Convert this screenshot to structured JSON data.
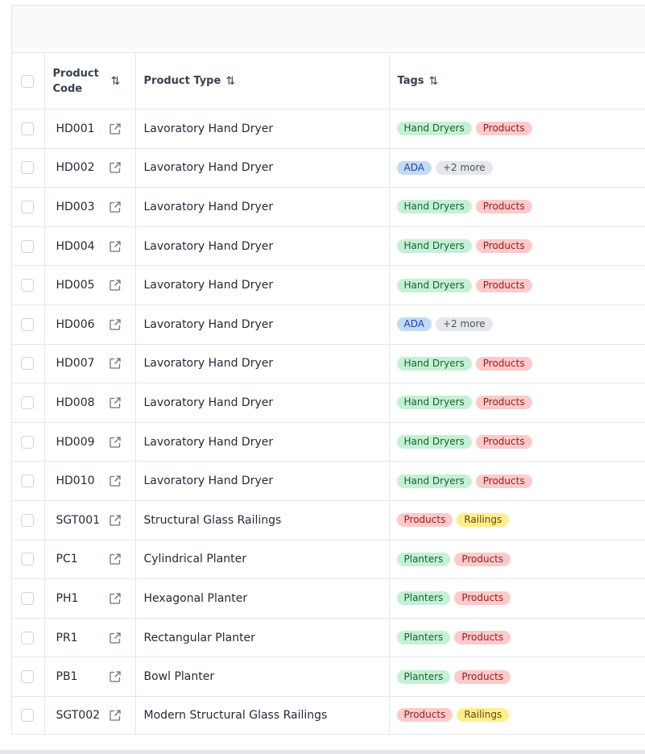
{
  "table": {
    "headers": {
      "code": "Product Code",
      "type": "Product Type",
      "tags": "Tags",
      "sort_glyph": "⇅"
    },
    "tag_colors": {
      "Hand Dryers": "#c6f0d4",
      "Products": "#fbcaca",
      "ADA": "#c3daf7",
      "+2 more": "#e5e7eb",
      "Railings": "#fdf08a",
      "Planters": "#c6f0d4"
    },
    "rows": [
      {
        "code": "HD001",
        "type": "Lavoratory Hand Dryer",
        "tags": [
          {
            "label": "Hand Dryers",
            "color": "green"
          },
          {
            "label": "Products",
            "color": "red"
          }
        ]
      },
      {
        "code": "HD002",
        "type": "Lavoratory Hand Dryer",
        "tags": [
          {
            "label": "ADA",
            "color": "blue"
          },
          {
            "label": "+2 more",
            "color": "gray"
          }
        ]
      },
      {
        "code": "HD003",
        "type": "Lavoratory Hand Dryer",
        "tags": [
          {
            "label": "Hand Dryers",
            "color": "green"
          },
          {
            "label": "Products",
            "color": "red"
          }
        ]
      },
      {
        "code": "HD004",
        "type": "Lavoratory Hand Dryer",
        "tags": [
          {
            "label": "Hand Dryers",
            "color": "green"
          },
          {
            "label": "Products",
            "color": "red"
          }
        ]
      },
      {
        "code": "HD005",
        "type": "Lavoratory Hand Dryer",
        "tags": [
          {
            "label": "Hand Dryers",
            "color": "green"
          },
          {
            "label": "Products",
            "color": "red"
          }
        ]
      },
      {
        "code": "HD006",
        "type": "Lavoratory Hand Dryer",
        "tags": [
          {
            "label": "ADA",
            "color": "blue"
          },
          {
            "label": "+2 more",
            "color": "gray"
          }
        ]
      },
      {
        "code": "HD007",
        "type": "Lavoratory Hand Dryer",
        "tags": [
          {
            "label": "Hand Dryers",
            "color": "green"
          },
          {
            "label": "Products",
            "color": "red"
          }
        ]
      },
      {
        "code": "HD008",
        "type": "Lavoratory Hand Dryer",
        "tags": [
          {
            "label": "Hand Dryers",
            "color": "green"
          },
          {
            "label": "Products",
            "color": "red"
          }
        ]
      },
      {
        "code": "HD009",
        "type": "Lavoratory Hand Dryer",
        "tags": [
          {
            "label": "Hand Dryers",
            "color": "green"
          },
          {
            "label": "Products",
            "color": "red"
          }
        ]
      },
      {
        "code": "HD010",
        "type": "Lavoratory Hand Dryer",
        "tags": [
          {
            "label": "Hand Dryers",
            "color": "green"
          },
          {
            "label": "Products",
            "color": "red"
          }
        ]
      },
      {
        "code": "SGT001",
        "type": "Structural Glass Railings",
        "tags": [
          {
            "label": "Products",
            "color": "red"
          },
          {
            "label": "Railings",
            "color": "yellow"
          }
        ]
      },
      {
        "code": "PC1",
        "type": "Cylindrical Planter",
        "tags": [
          {
            "label": "Planters",
            "color": "green"
          },
          {
            "label": "Products",
            "color": "red"
          }
        ]
      },
      {
        "code": "PH1",
        "type": "Hexagonal Planter",
        "tags": [
          {
            "label": "Planters",
            "color": "green"
          },
          {
            "label": "Products",
            "color": "red"
          }
        ]
      },
      {
        "code": "PR1",
        "type": "Rectangular Planter",
        "tags": [
          {
            "label": "Planters",
            "color": "green"
          },
          {
            "label": "Products",
            "color": "red"
          }
        ]
      },
      {
        "code": "PB1",
        "type": "Bowl Planter",
        "tags": [
          {
            "label": "Planters",
            "color": "green"
          },
          {
            "label": "Products",
            "color": "red"
          }
        ]
      },
      {
        "code": "SGT002",
        "type": "Modern Structural Glass Railings",
        "tags": [
          {
            "label": "Products",
            "color": "red"
          },
          {
            "label": "Railings",
            "color": "yellow"
          }
        ]
      }
    ]
  }
}
